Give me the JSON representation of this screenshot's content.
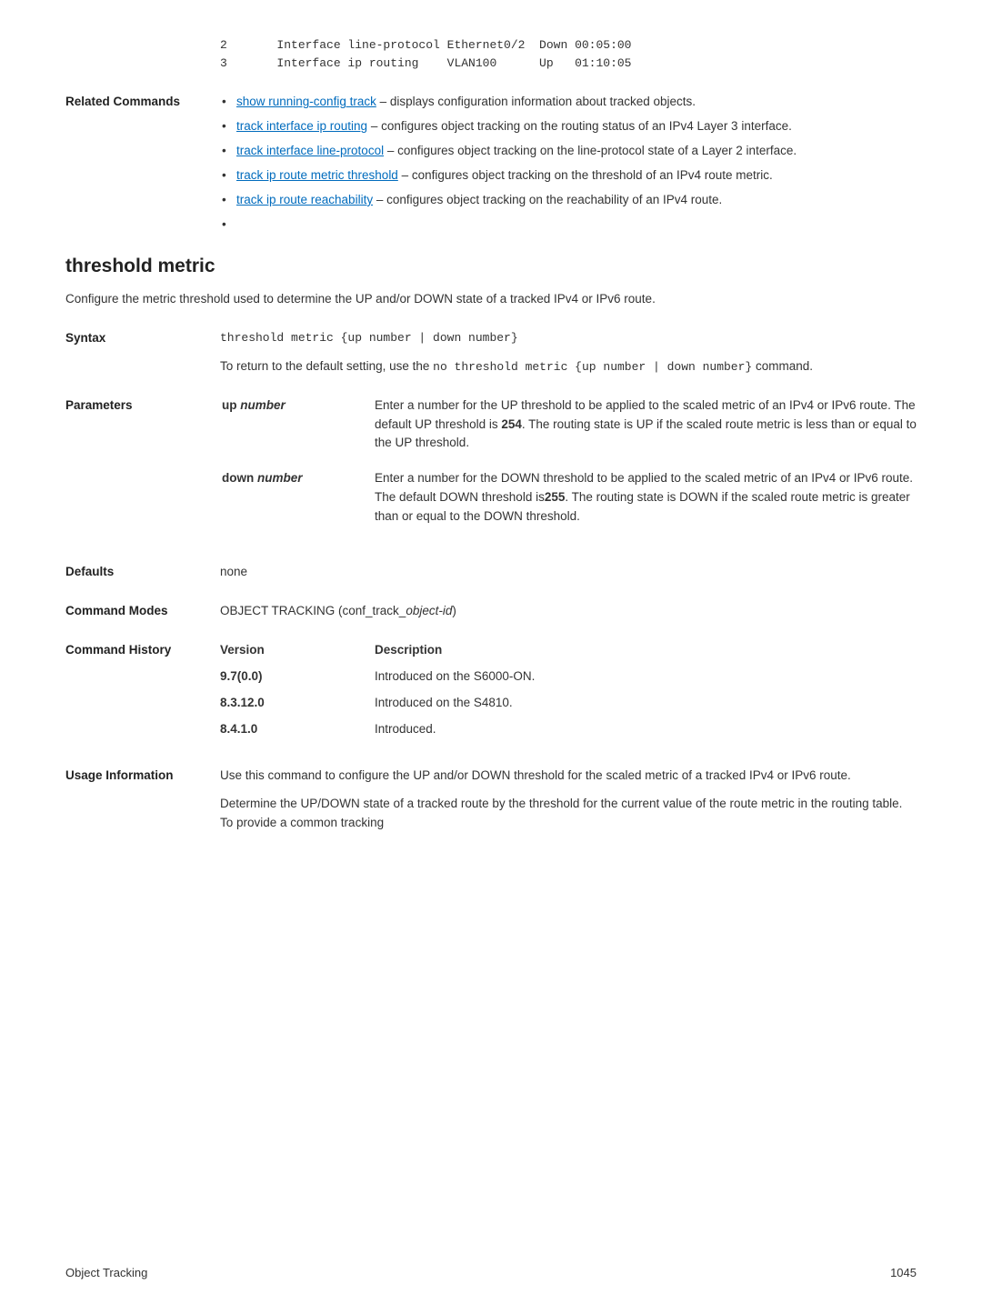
{
  "top_code": {
    "line1": "2       Interface line-protocol Ethernet0/2  Down 00:05:00",
    "line2": "3       Interface ip routing    VLAN100      Up   01:10:05"
  },
  "related": {
    "label": "Related Commands",
    "items": [
      {
        "link": "show running-config track",
        "rest": " – displays configuration information about tracked objects."
      },
      {
        "link": "track interface ip routing",
        "rest": " – configures object tracking on the routing status of an IPv4 Layer 3 interface."
      },
      {
        "link": "track interface line-protocol",
        "rest": " – configures object tracking on the line-protocol state of a Layer 2 interface."
      },
      {
        "link": "track ip route metric threshold",
        "rest": " – configures object tracking on the threshold of an IPv4 route metric."
      },
      {
        "link": "track ip route reachability",
        "rest": " – configures object tracking on the reachability of an IPv4 route."
      }
    ]
  },
  "section_title": "threshold metric",
  "section_intro": "Configure the metric threshold used to determine the UP and/or DOWN state of a tracked IPv4 or IPv6 route.",
  "syntax": {
    "label": "Syntax",
    "code": "threshold metric {up number | down number}",
    "return_pre": "To return to the default setting, use the ",
    "return_code": "no threshold metric {up number | down number}",
    "return_post": " command."
  },
  "parameters": {
    "label": "Parameters",
    "rows": [
      {
        "name_pre": "up ",
        "name_it": "number",
        "desc_pre": "Enter a number for the UP threshold to be applied to the scaled metric of an IPv4 or IPv6 route. The default UP threshold is ",
        "desc_bold": "254",
        "desc_post": ". The routing state is UP if the scaled route metric is less than or equal to the UP threshold."
      },
      {
        "name_pre": "down ",
        "name_it": "number",
        "desc_pre": "Enter a number for the DOWN threshold to be applied to the scaled metric of an IPv4 or IPv6 route. The default DOWN threshold is",
        "desc_bold": "255",
        "desc_post": ". The routing state is DOWN if the scaled route metric is greater than or equal to the DOWN threshold."
      }
    ]
  },
  "defaults": {
    "label": "Defaults",
    "value": "none"
  },
  "modes": {
    "label": "Command Modes",
    "pre": "OBJECT TRACKING (conf_track_",
    "it": "object-id",
    "post": ")"
  },
  "history": {
    "label": "Command History",
    "head_version": "Version",
    "head_desc": "Description",
    "rows": [
      {
        "v": "9.7(0.0)",
        "d": "Introduced on the S6000-ON."
      },
      {
        "v": "8.3.12.0",
        "d": "Introduced on the S4810."
      },
      {
        "v": "8.4.1.0",
        "d": "Introduced."
      }
    ]
  },
  "usage": {
    "label": "Usage Information",
    "p1": "Use this command to configure the UP and/or DOWN threshold for the scaled metric of a tracked IPv4 or IPv6 route.",
    "p2": "Determine the UP/DOWN state of a tracked route by the threshold for the current value of the route metric in the routing table. To provide a common tracking"
  },
  "footer": {
    "left": "Object Tracking",
    "right": "1045"
  }
}
